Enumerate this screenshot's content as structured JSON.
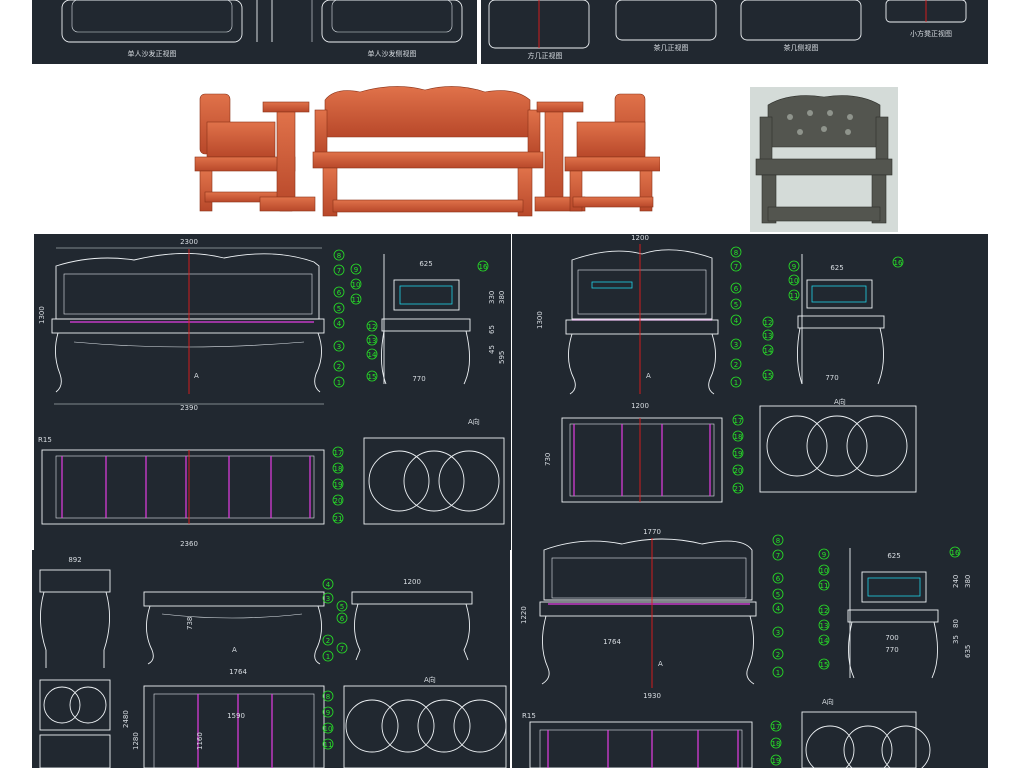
{
  "top_strip": {
    "labels": [
      "单人沙发正视图",
      "单人沙发侧视图",
      "方几正视图",
      "茶几正视图",
      "茶几侧视图",
      "小方凳正视图"
    ]
  },
  "drawing_tl": {
    "overall_width": "2300",
    "bottom_width": "2390",
    "seat_width": "2360",
    "side_width": "625",
    "side_depth": "770",
    "front_height": "1300",
    "seat_height": "770",
    "radius": "R15",
    "section_mark": "A向",
    "arrow": "A",
    "side_dims": [
      "330",
      "380",
      "65",
      "45",
      "595"
    ],
    "callouts": [
      "1",
      "2",
      "3",
      "4",
      "5",
      "6",
      "7",
      "8",
      "9",
      "10",
      "11",
      "12",
      "13",
      "14",
      "15",
      "16",
      "17",
      "18",
      "19",
      "20",
      "21"
    ]
  },
  "drawing_tr": {
    "front_width": "1200",
    "bottom_width": "1200",
    "side_width": "625",
    "side_depth": "770",
    "front_height": "1300",
    "section_mark": "A向",
    "arrow": "A",
    "table_width": "730",
    "callouts": [
      "1",
      "2",
      "3",
      "4",
      "5",
      "6",
      "7",
      "8",
      "9",
      "10",
      "11",
      "12",
      "13",
      "14",
      "15",
      "16",
      "17",
      "18",
      "19",
      "20",
      "21"
    ]
  },
  "drawing_bl": {
    "table_width": "1764",
    "top_width": "1200",
    "side_width": "892",
    "height": "738",
    "section_mark": "A向",
    "arrow": "A",
    "dims": [
      "1590",
      "1160",
      "2480",
      "1280"
    ],
    "callouts": [
      "1",
      "2",
      "3",
      "4",
      "5",
      "6",
      "7",
      "8",
      "9",
      "10",
      "11"
    ]
  },
  "drawing_br": {
    "overall_width": "1770",
    "seat_width": "1764",
    "bottom_width": "1930",
    "side_width": "625",
    "side_depth": "770",
    "side_base": "700",
    "front_height": "1220",
    "radius": "R15",
    "section_mark": "A向",
    "arrow": "A",
    "side_dims": [
      "240",
      "380",
      "80",
      "35",
      "635"
    ],
    "callouts": [
      "1",
      "2",
      "3",
      "4",
      "5",
      "6",
      "7",
      "8",
      "9",
      "10",
      "11",
      "12",
      "13",
      "14",
      "15",
      "16",
      "17",
      "18",
      "19"
    ]
  }
}
